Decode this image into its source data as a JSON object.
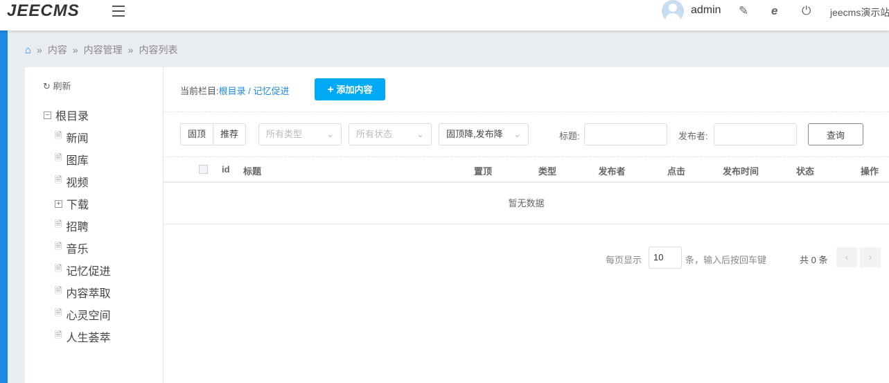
{
  "header": {
    "logo": "JEECMS",
    "username": "admin",
    "site": "jeecms演示站"
  },
  "breadcrumb": [
    "内容",
    "内容管理",
    "内容列表"
  ],
  "tree": {
    "refresh": "刷新",
    "root": "根目录",
    "items": [
      {
        "label": "新闻",
        "expandable": false
      },
      {
        "label": "图库",
        "expandable": false
      },
      {
        "label": "视频",
        "expandable": false
      },
      {
        "label": "下载",
        "expandable": true
      },
      {
        "label": "招聘",
        "expandable": false
      },
      {
        "label": "音乐",
        "expandable": false
      },
      {
        "label": "记忆促进",
        "expandable": false
      },
      {
        "label": "内容萃取",
        "expandable": false
      },
      {
        "label": "心灵空间",
        "expandable": false
      },
      {
        "label": "人生荟萃",
        "expandable": false
      }
    ]
  },
  "current": {
    "label": "当前栏目:",
    "path": "根目录 / 记忆促进"
  },
  "add_button": "添加内容",
  "filters": {
    "top": "固顶",
    "recommend": "推荐",
    "type": "所有类型",
    "status": "所有状态",
    "sort": "固顶降,发布降",
    "title_label": "标题:",
    "publisher_label": "发布者:",
    "query": "查询"
  },
  "table": {
    "columns": [
      "id",
      "标题",
      "置顶",
      "类型",
      "发布者",
      "点击",
      "发布时间",
      "状态",
      "操作"
    ],
    "empty": "暂无数据"
  },
  "pagination": {
    "per_page_label": "每页显示",
    "per_page": "10",
    "hint": "条，输入后按回车键",
    "total": "共 0 条"
  }
}
